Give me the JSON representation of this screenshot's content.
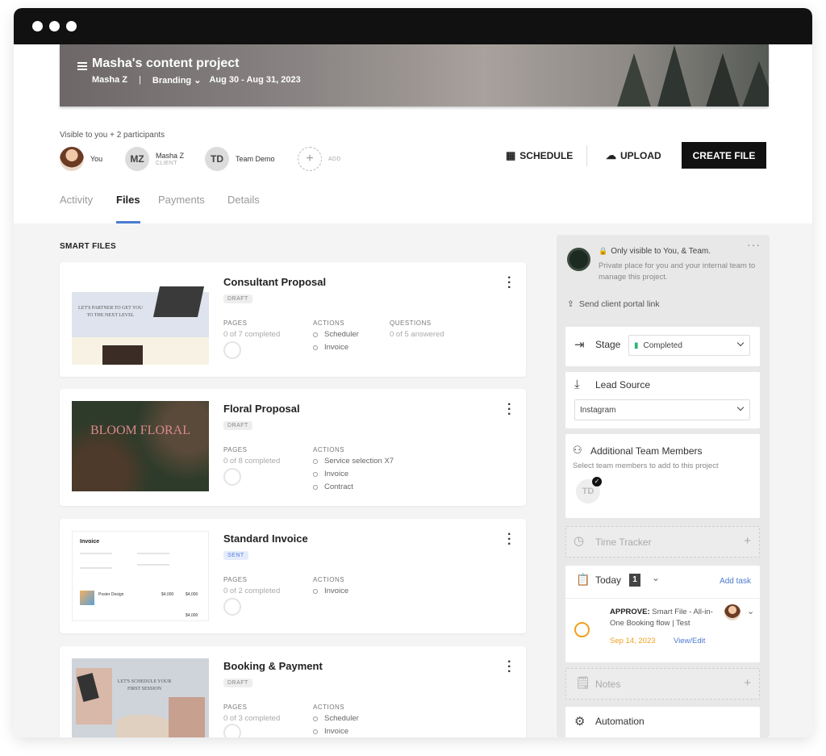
{
  "project": {
    "title": "Masha's content project",
    "owner": "Masha Z",
    "divider": "|",
    "type": "Branding",
    "dates": "Aug 30 - Aug 31, 2023"
  },
  "participants": {
    "visible_text": "Visible to you + 2 participants",
    "people": [
      {
        "initials": "",
        "name": "You",
        "sub": ""
      },
      {
        "initials": "MZ",
        "name": "Masha Z",
        "sub": "CLIENT"
      },
      {
        "initials": "TD",
        "name": "Team Demo",
        "sub": ""
      }
    ],
    "add_label": "ADD"
  },
  "toolbar": {
    "schedule": "SCHEDULE",
    "upload": "UPLOAD",
    "create_file": "CREATE FILE"
  },
  "tabs": [
    "Activity",
    "Files",
    "Payments",
    "Details"
  ],
  "active_tab": "Files",
  "section_label": "SMART FILES",
  "files": [
    {
      "title": "Consultant Proposal",
      "status": "DRAFT",
      "pages_label": "PAGES",
      "pages_value": "0 of 7 completed",
      "actions_label": "ACTIONS",
      "actions": [
        "Scheduler",
        "Invoice"
      ],
      "questions_label": "QUESTIONS",
      "questions_value": "0 of 5 answered",
      "thumb_text": "LET'S PARTNER TO GET YOU TO THE NEXT LEVEL"
    },
    {
      "title": "Floral Proposal",
      "status": "DRAFT",
      "pages_label": "PAGES",
      "pages_value": "0 of 8 completed",
      "actions_label": "ACTIONS",
      "actions": [
        "Service selection X7",
        "Invoice",
        "Contract"
      ],
      "thumb_text": "BLOOM FLORAL"
    },
    {
      "title": "Standard Invoice",
      "status": "SENT",
      "pages_label": "PAGES",
      "pages_value": "0 of 2 completed",
      "actions_label": "ACTIONS",
      "actions": [
        "Invoice"
      ],
      "thumb_title": "Invoice",
      "thumb_item": "Poster Design",
      "thumb_price": "$4,000",
      "thumb_total": "$4,000"
    },
    {
      "title": "Booking & Payment",
      "status": "DRAFT",
      "pages_label": "PAGES",
      "pages_value": "0 of 3 completed",
      "actions_label": "ACTIONS",
      "actions": [
        "Scheduler",
        "Invoice"
      ],
      "thumb_text": "LET'S SCHEDULE YOUR FIRST SESSION"
    }
  ],
  "side_panel": {
    "visibility_title": "Only visible to You, & Team.",
    "visibility_desc": "Private place for you and your internal team to manage this project.",
    "portal_link": "Send client portal link",
    "stage_label": "Stage",
    "stage_value": "Completed",
    "lead_source_label": "Lead Source",
    "lead_source_value": "Instagram",
    "team_title": "Additional Team Members",
    "team_desc": "Select team members to add to this project",
    "team_avatar": "TD",
    "time_tracker": "Time Tracker",
    "today_label": "Today",
    "today_count": "1",
    "add_task": "Add task",
    "task_prefix": "APPROVE:",
    "task_text": "Smart File - All-in-One Booking flow | Test",
    "task_date": "Sep 14, 2023",
    "task_link": "View/Edit",
    "notes": "Notes",
    "automation": "Automation"
  },
  "colors": {
    "accent": "#4a7bd1",
    "stage_green": "#2bb673",
    "task_orange": "#f0a020",
    "dark": "#111111"
  }
}
